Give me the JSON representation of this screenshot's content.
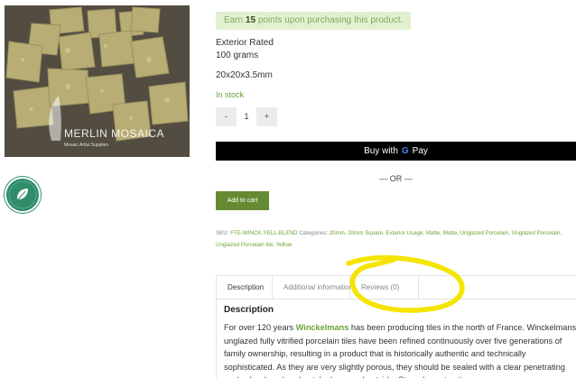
{
  "gallery": {
    "watermark_brand": "MERLIN MOSAICA",
    "watermark_tagline": "Mosaic Artist Supplies",
    "product_image_alt": "mosaic tiles"
  },
  "points": {
    "prefix": "Earn",
    "amount": "15",
    "suffix": "points upon purchasing this product."
  },
  "attributes": {
    "usage": "Exterior Rated",
    "weight": "100 grams",
    "size": "20x20x3.5mm"
  },
  "stock_status": "In stock",
  "quantity": {
    "minus_label": "-",
    "value": "1",
    "plus_label": "+"
  },
  "gpay": {
    "prefix": "Buy with",
    "g_letter": "G",
    "pay_label": "Pay"
  },
  "separator": "— OR —",
  "add_to_cart_label": "Add to cart",
  "meta": {
    "sku_label": "SKU:",
    "sku": "FTE-WINCK-YELL-BLEND",
    "categories_label": "Categories:",
    "categories": "20mm, 20mm Square, Exterior Usage, Matte, Matte, Unglazed Porcelain, Unglazed Porcelain, Unglazed Porcelain tile, Yellow"
  },
  "tabs": [
    {
      "label": "Description"
    },
    {
      "label": "Additional information"
    },
    {
      "label": "Reviews (0)"
    }
  ],
  "description": {
    "heading": "Description",
    "intro": "For over 120 years",
    "brand": "Winckelmans",
    "body": "has been producing tiles in the north of France. Winckelmans unglazed fully vitrified porcelain tiles have been refined continuously over five generations of family ownership, resulting in a product that is historically authentic and technically sophisticated.  As they are very slightly porous, they should be sealed with a clear penetrating sealer (such as bondcrete) when used outside.  Strongly contrasting"
  },
  "colors": {
    "accent_green": "#6aa535",
    "cart_button": "#658a32",
    "points_bg": "#e2f0d2",
    "annotation_yellow": "#f5e400",
    "badge": "#2f8d6a"
  },
  "icons": {
    "eco_badge": "leaf-badge-icon",
    "google": "google-g-icon"
  }
}
